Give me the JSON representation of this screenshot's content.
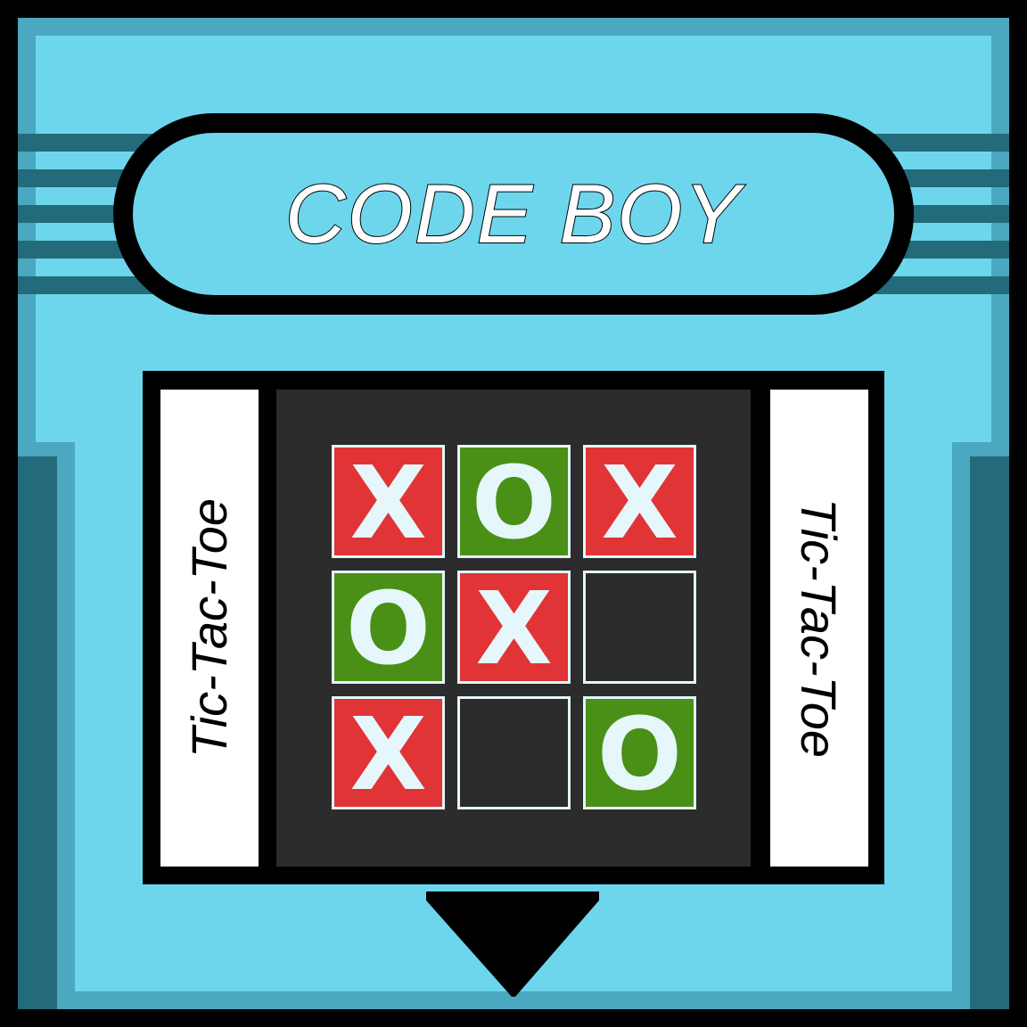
{
  "cartridge": {
    "brand": "CODE BOY",
    "label_left": "Tic-Tac-Toe",
    "label_right": "Tic-Tac-Toe",
    "colors": {
      "body": "#6dd6ec",
      "body_edge": "#4aa8c1",
      "body_dark": "#236b7a",
      "screen": "#2c2c2c",
      "x_tile": "#e03436",
      "o_tile": "#4a8f16",
      "mark": "#e6f7fb"
    }
  },
  "board": {
    "cells": [
      {
        "mark": "X"
      },
      {
        "mark": "O"
      },
      {
        "mark": "X"
      },
      {
        "mark": "O"
      },
      {
        "mark": "X"
      },
      {
        "mark": ""
      },
      {
        "mark": "X"
      },
      {
        "mark": ""
      },
      {
        "mark": "O"
      }
    ]
  },
  "insert_arrow": {
    "icon": "down-arrow-icon"
  }
}
